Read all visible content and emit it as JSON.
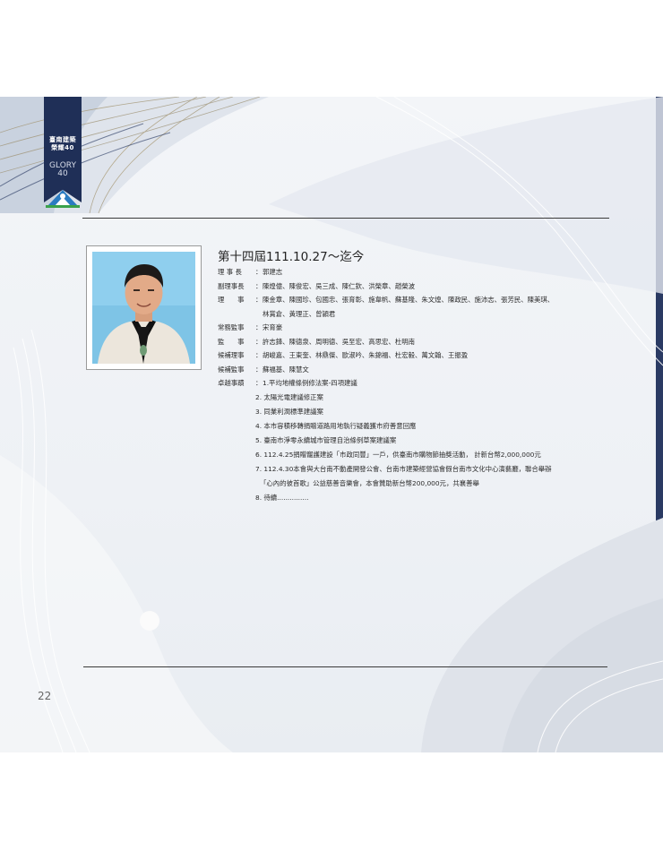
{
  "bookmark": {
    "line1": "臺南建築",
    "line2": "榮耀40",
    "glory": "GLORY",
    "num": "40"
  },
  "title": "第十四屆111.10.27～迄今",
  "roles": [
    {
      "label": "理 事 長",
      "value": "郭建志"
    },
    {
      "label": "副理事長",
      "value": "陳煌億、陳俊宏、吳三成、陳仁欽、洪榮章、趙榮波"
    },
    {
      "label": "理　　事",
      "value": "陳金章、陳國珍、包國忠、張育彰、施韋帆、蘇基隆、朱文煌、陳政民、施沛志、張芳民、陳美琪、",
      "cont": "林賞倉、黃理正、曾頴君"
    },
    {
      "label": "常務監事",
      "value": "宋育豪"
    },
    {
      "label": "監　　事",
      "value": "許志鋒、陳德泉、周明德、吳至宏、高思宏、杜明南"
    },
    {
      "label": "候補理事",
      "value": "胡峻嘉、王東奎、林鼎傑、歐淑吟、朱錦福、杜宏毅、萬文翰、王振盈"
    },
    {
      "label": "候補監事",
      "value": "蘇福基、陳慧文"
    }
  ],
  "achievements": {
    "label": "卓越事蹟",
    "first": "1.平均地權條例修法案-四項建議",
    "items": [
      "2. 太陽光電建議修正案",
      "3. 同業利潤標準建議案",
      "4. 本市容積移轉捐贈道路用地執行疑義獲市府善意回應",
      "5. 臺南市淨零永續城市管理自治條例草案建議案",
      "6. 112.4.25捐贈寵護建設「市政同豐」一戶，供臺南市購物節抽獎活動， 計新台幣2,000,000元",
      "7. 112.4.30本會與大台南不動產開發公會、台南市建築經營協會假台南市文化中心演藝廳，聯合舉辦"
    ],
    "item7_cont": "「心內的彼首歌」公益慈善音樂會，本會贊助新台幣200,000元，共襄善舉",
    "item8": "8. 待續..............."
  },
  "page_number": "22"
}
